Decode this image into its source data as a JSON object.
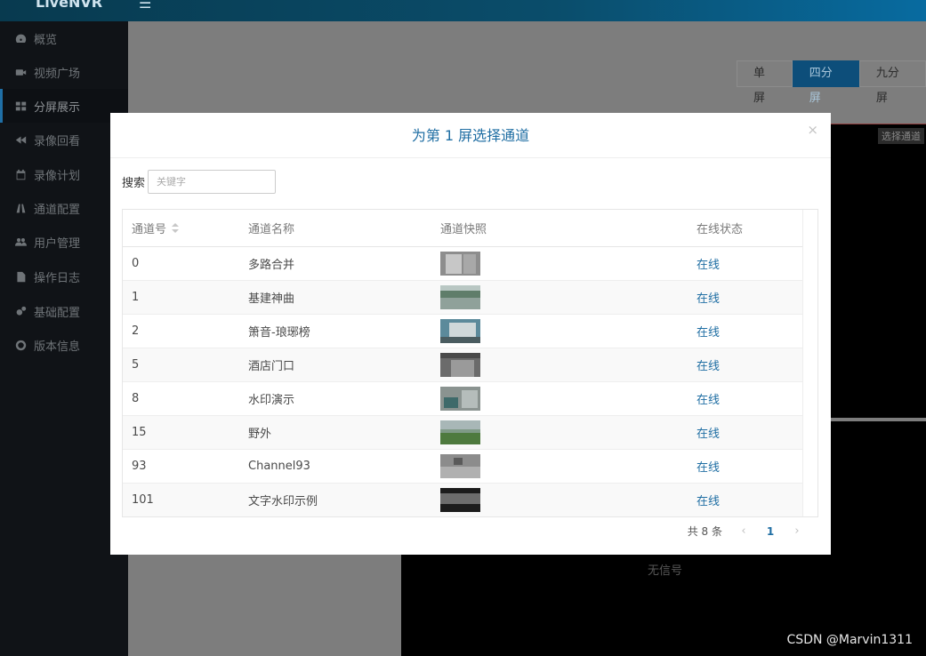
{
  "app": {
    "logo": "LiveNVR",
    "menu_icon": "☰"
  },
  "sidebar": {
    "items": [
      {
        "label": "概览",
        "icon": "dashboard-icon"
      },
      {
        "label": "视频广场",
        "icon": "video-camera-icon"
      },
      {
        "label": "分屏展示",
        "icon": "grid-icon",
        "active": true
      },
      {
        "label": "录像回看",
        "icon": "rewind-icon"
      },
      {
        "label": "录像计划",
        "icon": "calendar-icon"
      },
      {
        "label": "通道配置",
        "icon": "road-icon"
      },
      {
        "label": "用户管理",
        "icon": "users-icon"
      },
      {
        "label": "操作日志",
        "icon": "file-icon"
      },
      {
        "label": "基础配置",
        "icon": "gears-icon"
      },
      {
        "label": "版本信息",
        "icon": "lifebuoy-icon"
      }
    ]
  },
  "screen_switch": {
    "single": "单屏",
    "four": "四分屏",
    "nine": "九分屏",
    "active": "four"
  },
  "player": {
    "pick_channel": "选择通道",
    "no_signal": "无信号"
  },
  "modal": {
    "title": "为第 1 屏选择通道",
    "close": "×",
    "search_label": "搜索",
    "search_placeholder": "关键字",
    "columns": [
      "通道号",
      "通道名称",
      "通道快照",
      "在线状态"
    ],
    "rows": [
      {
        "id": "0",
        "name": "多路合并",
        "status": "在线"
      },
      {
        "id": "1",
        "name": "基建神曲",
        "status": "在线"
      },
      {
        "id": "2",
        "name": "箫音-琅琊榜",
        "status": "在线"
      },
      {
        "id": "5",
        "name": "酒店门口",
        "status": "在线"
      },
      {
        "id": "8",
        "name": "水印演示",
        "status": "在线"
      },
      {
        "id": "15",
        "name": "野外",
        "status": "在线"
      },
      {
        "id": "93",
        "name": "Channel93",
        "status": "在线"
      },
      {
        "id": "101",
        "name": "文字水印示例",
        "status": "在线"
      }
    ],
    "pager": {
      "total": "共 8 条",
      "prev": "‹",
      "page": "1",
      "next": "›"
    }
  },
  "watermark": "CSDN @Marvin1311",
  "colors": {
    "accent": "#1f6ea3",
    "header": "#0a4d6b",
    "sidebar": "#101317"
  }
}
